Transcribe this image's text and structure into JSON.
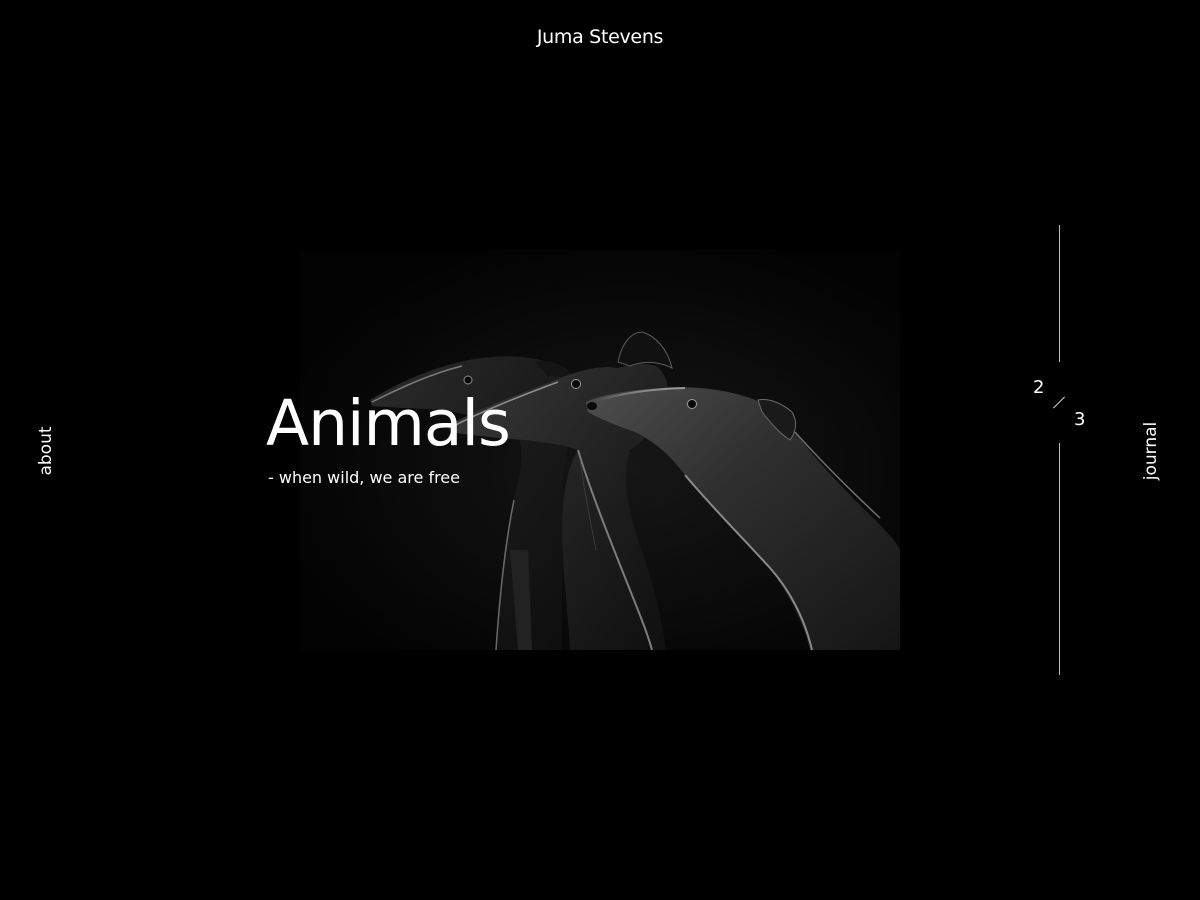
{
  "header": {
    "title": "Juma Stevens"
  },
  "nav": {
    "left_label": "about",
    "right_label": "journal"
  },
  "slide": {
    "title": "Animals",
    "subtitle": "- when wild, we are free",
    "image_subject": "three greyhounds silhouetted against black background"
  },
  "pager": {
    "current": "2",
    "total": "3"
  },
  "colors": {
    "background": "#000000",
    "text": "#ffffff",
    "divider": "#bdbdbd"
  }
}
